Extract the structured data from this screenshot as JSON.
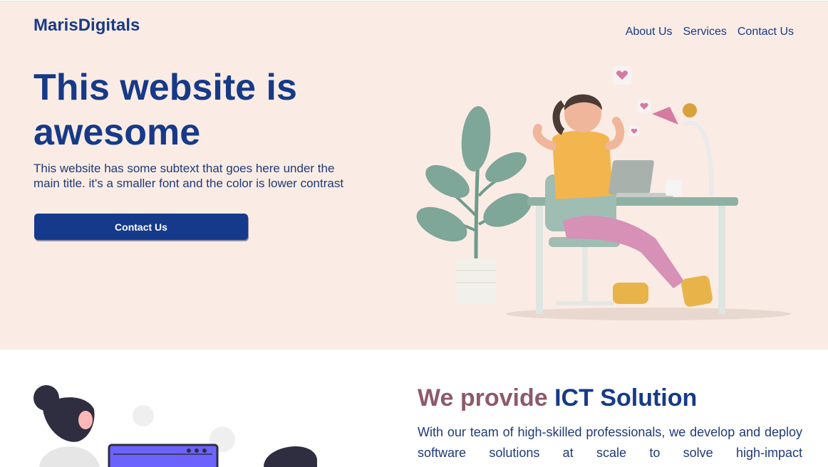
{
  "header": {
    "brand": "MarisDigitals",
    "nav": [
      "About Us",
      "Services",
      "Contact Us"
    ]
  },
  "hero": {
    "title": "This website is awesome",
    "subtitle": "This website has some subtext that goes here under the main title. it's a smaller font and the color is lower contrast",
    "cta_label": "Contact Us"
  },
  "services": {
    "title_part1": "We provide",
    "title_part2": "ICT Solution",
    "body": "With our team of high-skilled professionals, we develop and deploy software solutions at scale to solve high-impact"
  },
  "colors": {
    "hero_bg": "#faece5",
    "primary": "#163a88",
    "accent": "#8d5a6b"
  }
}
